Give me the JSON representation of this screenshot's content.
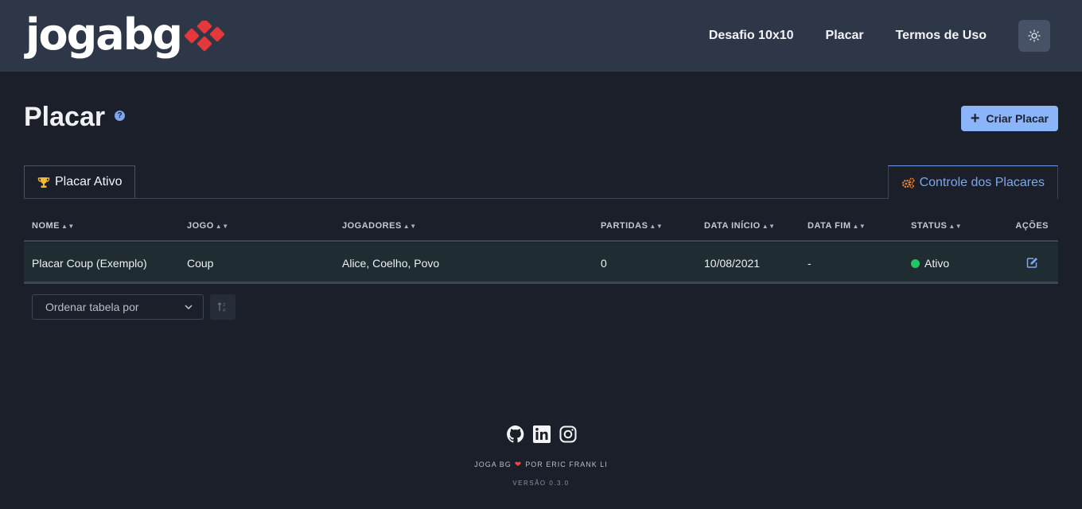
{
  "header": {
    "logo_text": "jogabg",
    "nav": [
      "Desafio 10x10",
      "Placar",
      "Termos de Uso"
    ],
    "theme_icon": "sun-icon"
  },
  "page": {
    "title": "Placar",
    "help_icon": "question-circle-icon",
    "create_button": "Criar Placar"
  },
  "tabs": {
    "active_label": "Placar Ativo",
    "active_icon": "trophy-icon",
    "control_label": "Controle dos Placares",
    "control_icon": "cogs-icon"
  },
  "table": {
    "columns": [
      "NOME",
      "JOGO",
      "JOGADORES",
      "PARTIDAS",
      "DATA INÍCIO",
      "DATA FIM",
      "STATUS",
      "AÇÕES"
    ],
    "rows": [
      {
        "nome": "Placar Coup (Exemplo)",
        "jogo": "Coup",
        "jogadores": "Alice, Coelho, Povo",
        "partidas": "0",
        "data_inicio": "10/08/2021",
        "data_fim": "-",
        "status": "Ativo",
        "acao_icon": "edit-icon"
      }
    ]
  },
  "sort": {
    "placeholder": "Ordenar tabela por",
    "direction_icon": "sort-alpha-up-icon"
  },
  "footer": {
    "social_icons": [
      "github-icon",
      "linkedin-icon",
      "instagram-icon"
    ],
    "credit_left": "JOGA BG",
    "credit_right": "POR ERIC FRANK LI",
    "version": "VERSÃO 0.3.0"
  },
  "colors": {
    "header_bg": "#2e3748",
    "page_bg": "#1b1f2a",
    "accent": "#8cb4f8",
    "logo_red": "#e5383b",
    "status_active": "#22c55e",
    "heart": "#ef4444"
  }
}
